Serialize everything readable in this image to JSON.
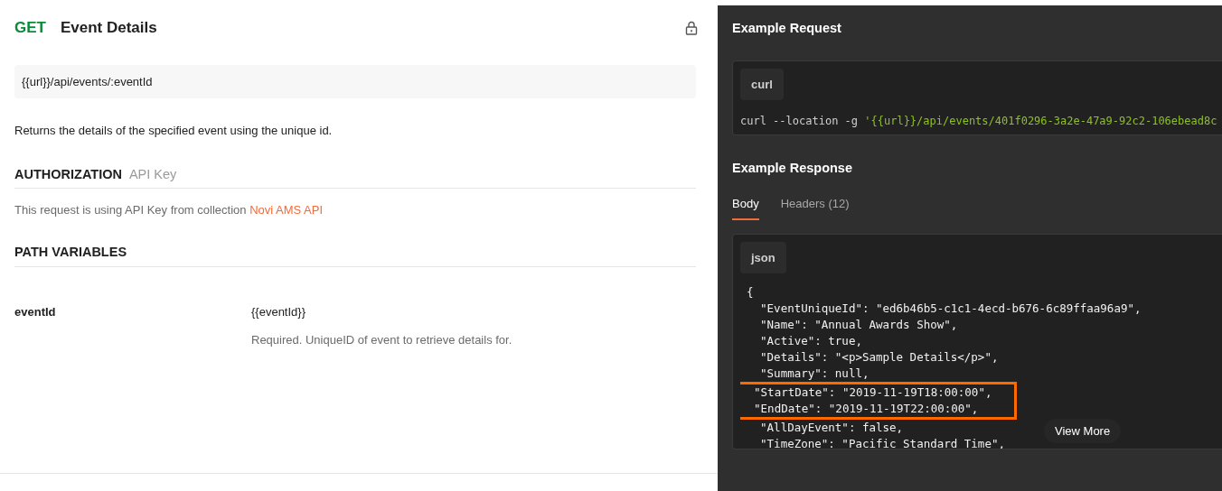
{
  "request": {
    "method": "GET",
    "title": "Event Details",
    "url": "{{url}}/api/events/:eventId",
    "description": "Returns the details of the specified event using the unique id.",
    "authorization": {
      "heading": "AUTHORIZATION",
      "type": "API Key",
      "text": "This request is using API Key from collection ",
      "link": "Novi AMS API"
    },
    "path_variables": {
      "heading": "PATH VARIABLES",
      "rows": [
        {
          "key": "eventId",
          "value": "{{eventId}}",
          "description": "Required. UniqueID of event to retrieve details for."
        }
      ]
    }
  },
  "example_request": {
    "title": "Example Request",
    "language": "curl",
    "code_plain": "curl --location -g ",
    "code_string": "'{{url}}/api/events/401f0296-3a2e-47a9-92c2-106ebead8c"
  },
  "example_response": {
    "title": "Example Response",
    "tabs": [
      {
        "label": "Body",
        "selected": true
      },
      {
        "label": "Headers (12)",
        "selected": false
      }
    ],
    "language": "json",
    "lines": [
      {
        "text": "{",
        "highlighted": false
      },
      {
        "text": "  \"EventUniqueId\": \"ed6b46b5-c1c1-4ecd-b676-6c89ffaa96a9\",",
        "highlighted": false
      },
      {
        "text": "  \"Name\": \"Annual Awards Show\",",
        "highlighted": false
      },
      {
        "text": "  \"Active\": true,",
        "highlighted": false
      },
      {
        "text": "  \"Details\": \"<p>Sample Details</p>\",",
        "highlighted": false
      },
      {
        "text": "  \"Summary\": null,",
        "highlighted": false
      },
      {
        "text": "  \"StartDate\": \"2019-11-19T18:00:00\",",
        "highlighted": true
      },
      {
        "text": "  \"EndDate\": \"2019-11-19T22:00:00\",",
        "highlighted": true
      },
      {
        "text": "  \"AllDayEvent\": false,",
        "highlighted": false
      },
      {
        "text": "  \"TimeZone\": \"Pacific Standard Time\",",
        "highlighted": false
      }
    ],
    "view_more": "View More"
  }
}
